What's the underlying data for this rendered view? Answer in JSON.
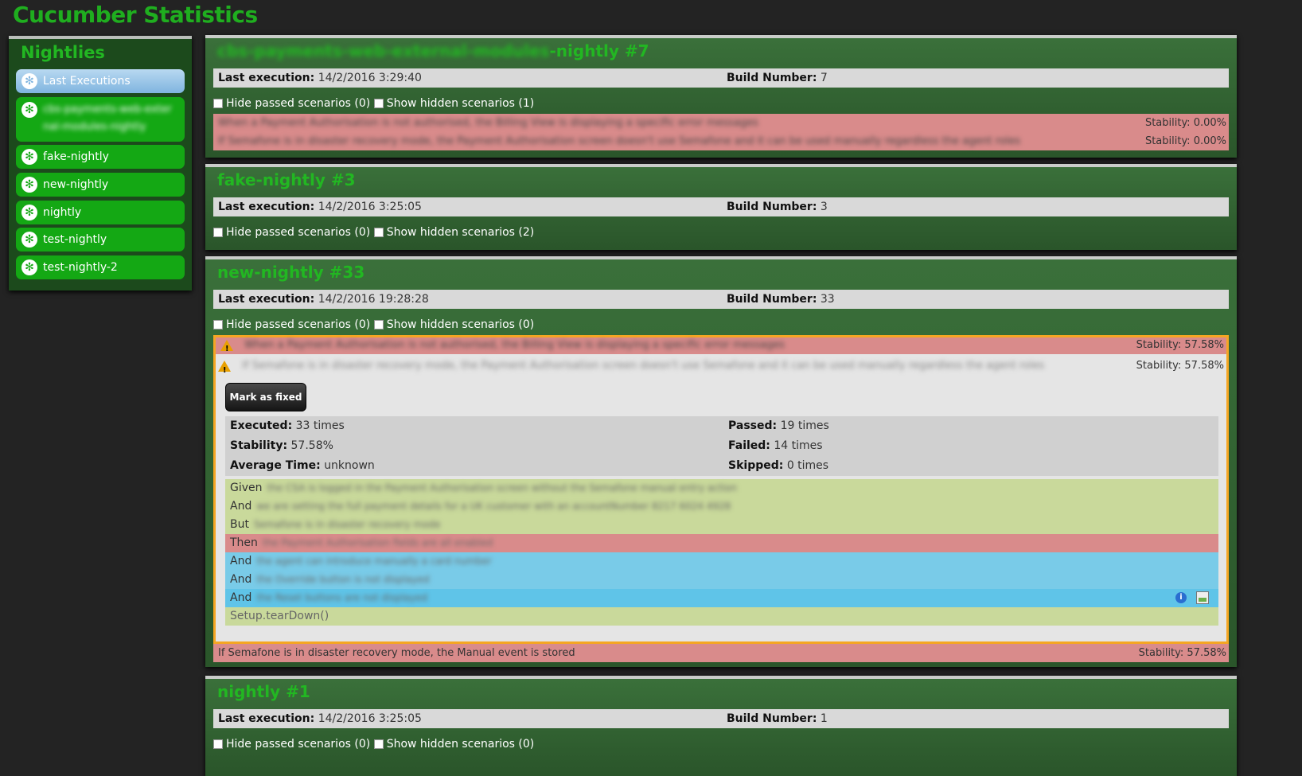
{
  "app": {
    "title": "Cucumber Statistics"
  },
  "sidebar": {
    "title": "Nightlies",
    "items": [
      {
        "label": "Last Executions",
        "active": true
      },
      {
        "label": "cbs-payments-web-external-modules-nightly",
        "blurred": true
      },
      {
        "label": "fake-nightly"
      },
      {
        "label": "new-nightly"
      },
      {
        "label": "nightly"
      },
      {
        "label": "test-nightly"
      },
      {
        "label": "test-nightly-2"
      }
    ]
  },
  "labels": {
    "last_execution": "Last execution:",
    "build_number": "Build Number:",
    "hide_passed": "Hide passed scenarios",
    "show_hidden": "Show hidden scenarios",
    "executed": "Executed:",
    "stability": "Stability:",
    "average_time": "Average Time:",
    "passed": "Passed:",
    "failed": "Failed:",
    "skipped": "Skipped:",
    "mark_fixed": "Mark as fixed"
  },
  "panels": [
    {
      "title_blur": "cbs-payments-web-external-modules",
      "title_suffix": "-nightly #7",
      "last_execution": "14/2/2016 3:29:40",
      "build_number": "7",
      "hide_passed_count": "(0)",
      "show_hidden_count": "(1)",
      "scenarios": [
        {
          "text": "When a Payment Authorisation is not authorised, the Billing View is displaying a specific error messages",
          "stability": "Stability: 0.00%"
        },
        {
          "text": "If Semafone is in disaster recovery mode, the Payment Authorisation screen doesn't use Semafone and it can be used manually regardless the agent roles",
          "stability": "Stability: 0.00%"
        }
      ]
    },
    {
      "title": "fake-nightly #3",
      "last_execution": "14/2/2016 3:25:05",
      "build_number": "3",
      "hide_passed_count": "(0)",
      "show_hidden_count": "(2)"
    },
    {
      "title": "new-nightly #33",
      "last_execution": "14/2/2016 19:28:28",
      "build_number": "33",
      "hide_passed_count": "(0)",
      "show_hidden_count": "(0)",
      "scenarios": [
        {
          "text": "When a Payment Authorisation is not authorised, the Billing View is displaying a specific error messages",
          "stability": "Stability: 57.58%"
        },
        {
          "text": "If Semafone is in disaster recovery mode, the Payment Authorisation screen doesn't use Semafone and it can be used manually regardless the agent roles",
          "stability": "Stability: 57.58%"
        },
        {
          "text": "If Semafone is in disaster recovery mode, the Manual event is stored",
          "stability": "Stability: 57.58%"
        }
      ],
      "details": {
        "executed": "33 times",
        "stability": "57.58%",
        "average_time": "unknown",
        "passed": "19 times",
        "failed": "14 times",
        "skipped": "0 times"
      },
      "steps": [
        {
          "keyword": "Given",
          "text": "the CSA is logged in the Payment Authorisation screen without the Semafone manual entry action",
          "status": "passed"
        },
        {
          "keyword": "And",
          "text": "we are setting the full payment details for a UK customer with an accountNumber 8217 6024 4928",
          "status": "passed"
        },
        {
          "keyword": "But",
          "text": "Semafone is in disaster recovery mode",
          "status": "passed"
        },
        {
          "keyword": "Then",
          "text": "the Payment Authorisation fields are all enabled",
          "status": "failed"
        },
        {
          "keyword": "And",
          "text": "the agent can introduce manually a card number",
          "status": "skipped"
        },
        {
          "keyword": "And",
          "text": "the Override button is not displayed",
          "status": "skipped"
        },
        {
          "keyword": "And",
          "text": "the Reset buttons are not displayed",
          "status": "skipped"
        },
        {
          "keyword": "",
          "text": "Setup.tearDown()",
          "status": "passed"
        }
      ]
    },
    {
      "title": "nightly #1",
      "last_execution": "14/2/2016 3:25:05",
      "build_number": "1",
      "hide_passed_count": "(0)",
      "show_hidden_count": "(0)"
    }
  ],
  "icons": {
    "warning": "warning-icon",
    "info": "info-icon",
    "image": "image-icon",
    "sidebar": "cucumber-icon"
  },
  "colors": {
    "accent": "#22b722",
    "passed": "#c9d99b",
    "failed": "#d98b8b",
    "skipped": "#79cbe8",
    "warning": "#f5a623"
  }
}
